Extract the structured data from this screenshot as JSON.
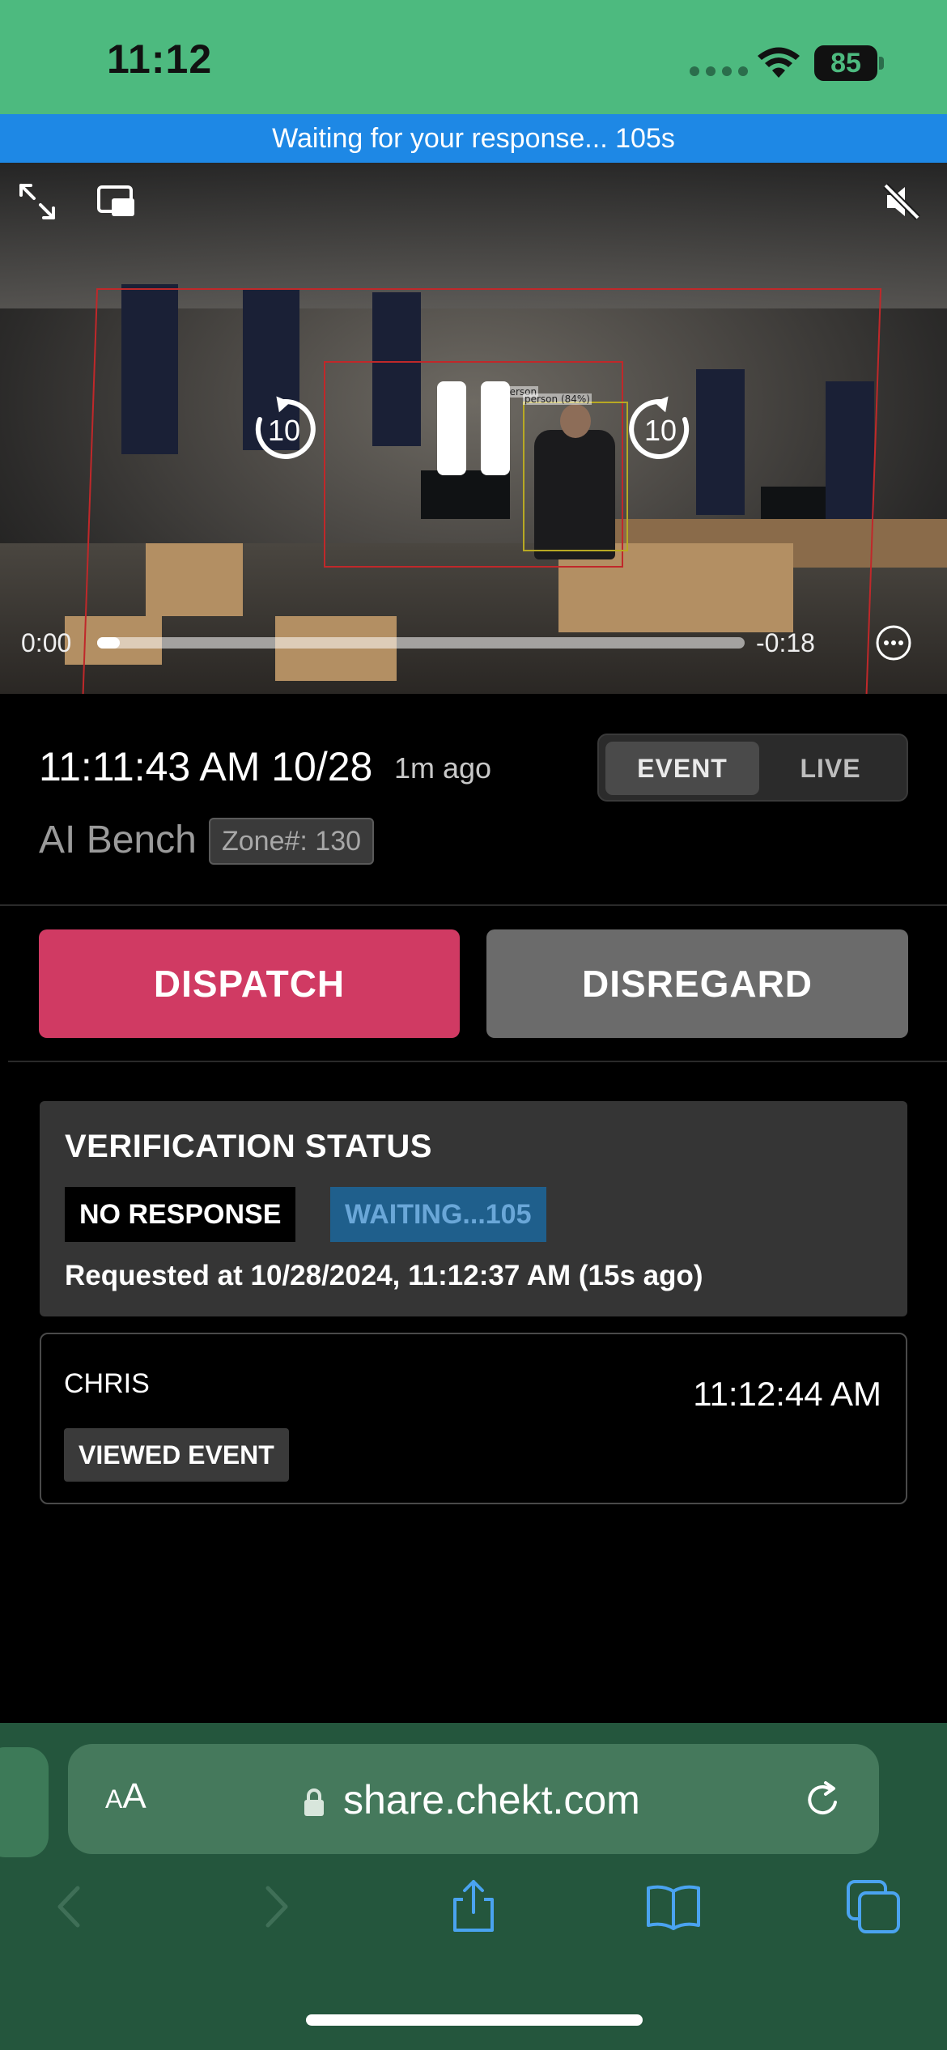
{
  "status_bar": {
    "time": "11:12",
    "battery": "85"
  },
  "banner": {
    "text": "Waiting for your response... 105s"
  },
  "video": {
    "detection_label": "person (84%)",
    "detection_label_secondary": "person",
    "skip_back_label": "10",
    "skip_forward_label": "10",
    "current_time": "0:00",
    "remaining_time": "-0:18",
    "progress_fraction": 0.02
  },
  "event": {
    "timestamp": "11:11:43 AM 10/28",
    "ago": "1m ago",
    "device": "AI Bench",
    "zone": "Zone#: 130",
    "mode_tabs": [
      {
        "label": "EVENT",
        "selected": true
      },
      {
        "label": "LIVE",
        "selected": false
      }
    ]
  },
  "actions": {
    "dispatch_label": "DISPATCH",
    "disregard_label": "DISREGARD"
  },
  "verification": {
    "title": "VERIFICATION STATUS",
    "status_badge": "NO RESPONSE",
    "waiting_badge": "WAITING...105",
    "requested": "Requested at 10/28/2024, 11:12:37 AM (15s ago)"
  },
  "viewer": {
    "name": "CHRIS",
    "time": "11:12:44 AM",
    "action_badge": "VIEWED EVENT"
  },
  "browser": {
    "aa_label_small": "A",
    "aa_label_large": "A",
    "url": "share.chekt.com"
  },
  "icons": {
    "expand": "expand-icon",
    "pip": "picture-in-picture-icon",
    "mute": "speaker-muted-icon",
    "more": "more-options-icon",
    "lock": "lock-icon",
    "reload": "reload-icon",
    "back": "back-arrow-icon",
    "forward": "forward-arrow-icon",
    "share": "share-icon",
    "bookmarks": "book-icon",
    "tabs": "tabs-icon"
  },
  "colors": {
    "status_bar": "#4dba7f",
    "banner": "#1e88e5",
    "dispatch": "#d03a63",
    "disregard": "#6b6b6b",
    "browser_bar": "#24563d",
    "toolbar_icons": "#4aa3f0"
  }
}
